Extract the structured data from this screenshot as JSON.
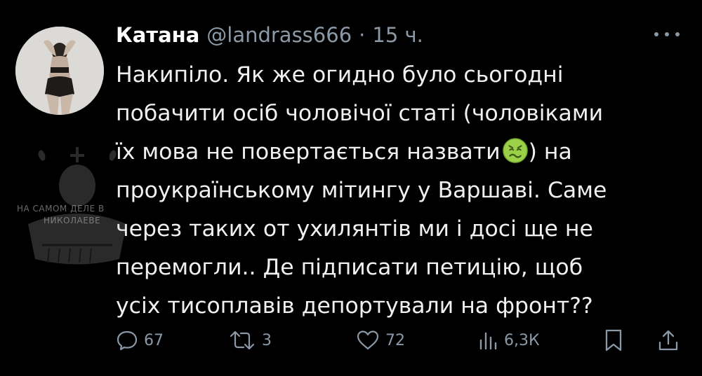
{
  "tweet": {
    "display_name": "Катана",
    "handle": "@landrass666",
    "separator": "·",
    "time": "15 ч.",
    "text_lines": [
      "Накипіло. Як же огидно було сьогодні",
      "побачити осіб чоловічої статі (чоловіками",
      "їх мова не повертається назвати",
      ") на",
      "проукраїнському мітингу у Варшаві. Саме",
      "через таких от ухилянтів ми і досі ще не",
      "перемогли.. Де підписати петицію, щоб",
      "усіх тисоплавів депортували на фронт??"
    ],
    "emoji_name": "nauseated-face-icon"
  },
  "watermark": {
    "line1": "НА САМОМ ДЕЛЕ В",
    "line2": "НИКОЛАЕВЕ"
  },
  "actions": {
    "replies": "67",
    "reposts": "3",
    "likes": "72",
    "views": "6,3К"
  },
  "colors": {
    "background": "#000000",
    "text": "#e7e9ea",
    "muted": "#8b98a5"
  }
}
